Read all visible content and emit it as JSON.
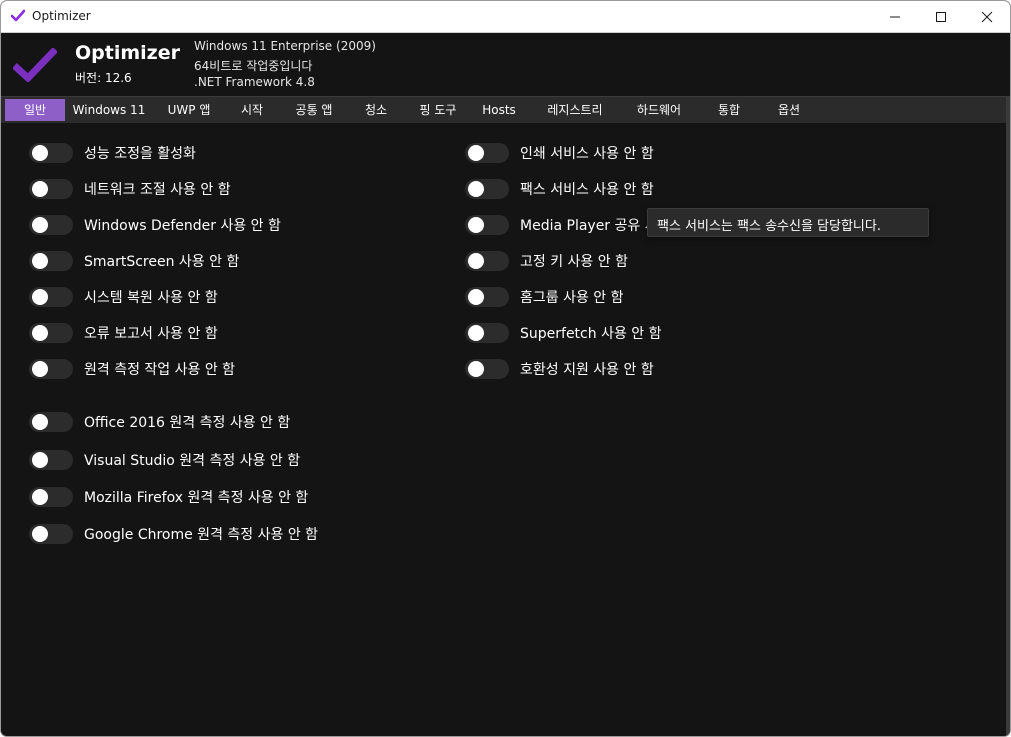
{
  "window": {
    "title": "Optimizer"
  },
  "header": {
    "app_name": "Optimizer",
    "version": "버전: 12.6",
    "sysinfo": [
      "Windows 11 Enterprise (2009)",
      "64비트로 작업중입니다",
      ".NET Framework 4.8"
    ]
  },
  "tabs": [
    {
      "label": "일반"
    },
    {
      "label": "Windows 11"
    },
    {
      "label": "UWP 앱"
    },
    {
      "label": "시작"
    },
    {
      "label": "공통 앱"
    },
    {
      "label": "청소"
    },
    {
      "label": "핑 도구"
    },
    {
      "label": "Hosts"
    },
    {
      "label": "레지스트리"
    },
    {
      "label": "하드웨어"
    },
    {
      "label": "통합"
    },
    {
      "label": "옵션"
    }
  ],
  "active_tab": "일반",
  "left_toggles": [
    {
      "label": "성능 조정을 활성화",
      "on": false
    },
    {
      "label": "네트워크 조절 사용 안 함",
      "on": false
    },
    {
      "label": "Windows Defender 사용 안 함",
      "on": false
    },
    {
      "label": "SmartScreen 사용 안 함",
      "on": false
    },
    {
      "label": "시스템 복원 사용 안 함",
      "on": false
    },
    {
      "label": "오류 보고서 사용 안 함",
      "on": false
    },
    {
      "label": "원격 측정 작업 사용 안 함",
      "on": false
    }
  ],
  "right_toggles": [
    {
      "label": "인쇄 서비스 사용 안 함",
      "on": false
    },
    {
      "label": "팩스 서비스 사용 안 함",
      "on": false
    },
    {
      "label": "Media Player 공유 사",
      "on": false
    },
    {
      "label": "고정 키 사용 안 함",
      "on": false
    },
    {
      "label": "홈그룹 사용 안 함",
      "on": false
    },
    {
      "label": "Superfetch 사용 안 함",
      "on": false
    },
    {
      "label": "호환성 지원 사용 안 함",
      "on": false
    }
  ],
  "telemetry_toggles": [
    {
      "label": "Office 2016 원격 측정 사용 안 함",
      "on": false
    },
    {
      "label": "Visual Studio 원격 측정 사용 안 함",
      "on": false
    },
    {
      "label": "Mozilla Firefox 원격 측정 사용 안 함",
      "on": false
    },
    {
      "label": "Google Chrome 원격 측정 사용 안 함",
      "on": false
    }
  ],
  "tooltip": {
    "text": "팩스 서비스는 팩스 송수신을 담당합니다."
  },
  "colors": {
    "accent": "#8e5fc7",
    "logo": "#7b2fbf",
    "background": "#141414",
    "tabbar": "#2b2b2b"
  }
}
